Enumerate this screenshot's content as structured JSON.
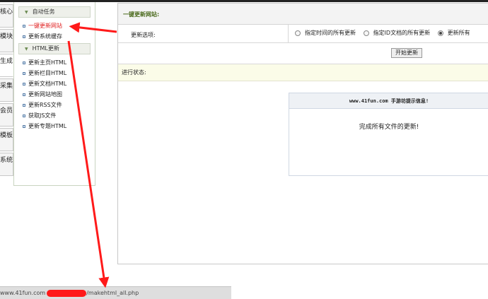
{
  "vtabs": [
    "核心",
    "模块",
    "生成",
    "采集",
    "会员",
    "模板",
    "系统"
  ],
  "menu": {
    "group1_title": "自动任务",
    "group1_items": [
      "一键更新网站",
      "更新系统缓存"
    ],
    "group2_title": "HTML更新",
    "group2_items": [
      "更新主页HTML",
      "更新栏目HTML",
      "更新文档HTML",
      "更新网站地图",
      "更新RSS文件",
      "获取JS文件",
      "更新专题HTML"
    ]
  },
  "main": {
    "title": "一键更新网站:",
    "option_label": "更新选项:",
    "options": [
      "指定时间的所有更新",
      "指定ID文档的所有更新",
      "更新所有"
    ],
    "selected_option": "更新所有",
    "start_button": "开始更新",
    "status_label": "进行状态:"
  },
  "message": {
    "header": "www.41fun.com 手游坊提示信息!",
    "body": "完成所有文件的更新!"
  },
  "statusbar": {
    "prefix": "www.41fun.com",
    "suffix": "/makehtml_all.php"
  },
  "colors": {
    "annotation": "#ff1a1a",
    "title_green": "#4a6a1c"
  }
}
